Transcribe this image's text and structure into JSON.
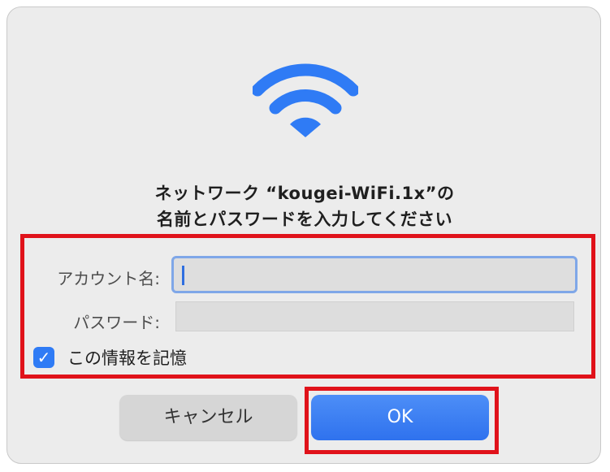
{
  "dialog": {
    "title_line1": "ネットワーク “kougei-WiFi.1x”の",
    "title_line2": "名前とパスワードを入力してください",
    "icon": "wifi-icon"
  },
  "form": {
    "account_label": "アカウント名:",
    "account_value": "",
    "password_label": "パスワード:",
    "password_value": "",
    "remember_label": "この情報を記憶",
    "remember_checked": true
  },
  "buttons": {
    "cancel": "キャンセル",
    "ok": "OK"
  },
  "colors": {
    "accent": "#2f7bf5",
    "highlight": "#e0121a"
  }
}
